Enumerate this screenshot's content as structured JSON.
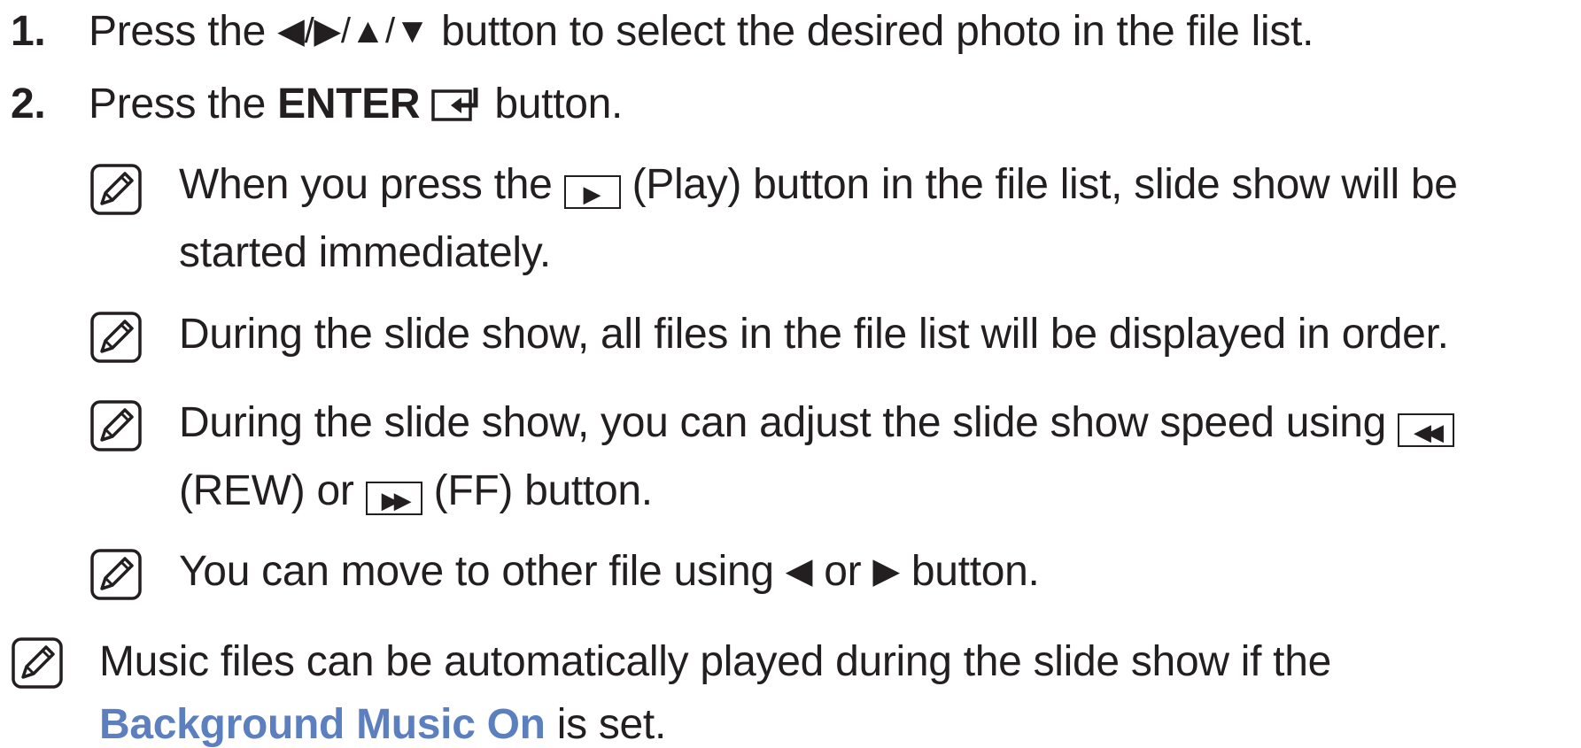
{
  "steps": [
    {
      "number": "1.",
      "prefix": "Press the ",
      "arrows": "◀/▶/▲/▼",
      "suffix": " button to select the desired photo in the file list."
    },
    {
      "number": "2.",
      "prefix": "Press the ",
      "bold": "ENTER",
      "icon": "enter-icon",
      "suffix": " button."
    }
  ],
  "notes": {
    "note1": {
      "part1": "When you press the ",
      "play_icon": "▶",
      "part2": " (Play) button in the file list, slide show will be",
      "line2": "started immediately."
    },
    "note2": {
      "text": "During the slide show, all files in the file list will be displayed in order."
    },
    "note3": {
      "part1": "During the slide show, you can adjust the slide show speed using ",
      "rew_icon": "◀◀",
      "line2_part1": "(REW) or ",
      "ff_icon": "▶▶",
      "line2_part2": " (FF) button."
    },
    "note4": {
      "part1": "You can move to other file using ",
      "left": "◀",
      "mid": " or ",
      "right": "▶",
      "part2": " button."
    },
    "note5": {
      "line1": "Music files can be automatically played during the slide show if the",
      "link": "Background Music On",
      "line2_suffix": " is set."
    }
  },
  "colors": {
    "text": "#231f20",
    "link": "#5b7fbf"
  },
  "icons": {
    "note": "note-pencil-icon"
  }
}
